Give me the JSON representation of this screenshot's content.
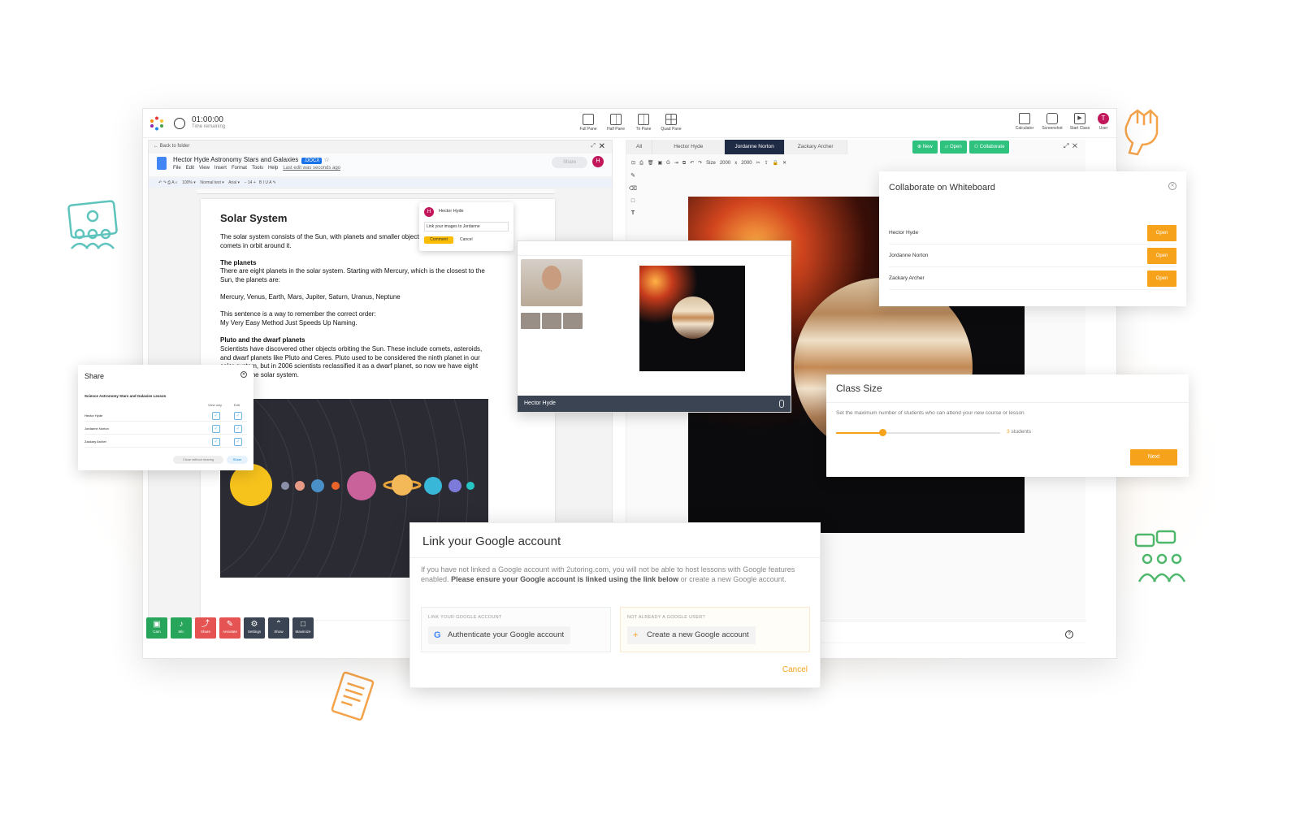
{
  "app": {
    "timer": {
      "value": "01:00:00",
      "label": "Time remaining"
    },
    "pane_modes": [
      "Full Pane",
      "Half Pane",
      "Tri Pane",
      "Quad Pane"
    ],
    "tools": [
      "Calculator",
      "Screenshot",
      "Start Class",
      "User"
    ],
    "user_initial": "T"
  },
  "doc": {
    "back": "Back to folder",
    "title": "Hector Hyde Astronomy Stars and Galaxies",
    "badge": ".DOCX",
    "menu": [
      "File",
      "Edit",
      "View",
      "Insert",
      "Format",
      "Tools",
      "Help"
    ],
    "last_edit": "Last edit was seconds ago",
    "share_label": "Share",
    "user_initial": "H",
    "toolbar": {
      "zoom": "100%",
      "style": "Normal text",
      "font": "Arial",
      "size": "14"
    },
    "heading": "Solar System",
    "paragraphs": {
      "p1": "The solar system consists of the Sun, with planets and smaller objects such as asteroids and comets in orbit around it.",
      "h2": "The planets",
      "p2": "There are eight planets in the solar system. Starting with Mercury, which is the closest to the Sun, the planets are:",
      "p3": "Mercury, Venus, Earth, Mars, Jupiter, Saturn, Uranus, Neptune",
      "p4": "This sentence is a way to remember the correct order:",
      "p5": "My Very Easy Method Just Speeds Up Naming.",
      "h3": "Pluto and the dwarf planets",
      "p6": "Scientists have discovered other objects orbiting the Sun. These include comets, asteroids, and dwarf planets like Pluto and Ceres. Pluto used to be considered the ninth planet in our solar system, but in 2006 scientists reclassified it as a dwarf planet, so now we have eight planets in the solar system."
    },
    "comment": {
      "author": "Hector Hyde",
      "text": "Link your images to Jordanne",
      "comment_btn": "Comment",
      "cancel_btn": "Cancel"
    }
  },
  "controls": [
    {
      "label": "Cam",
      "color": "#27a55a",
      "glyph": "▣"
    },
    {
      "label": "Mic",
      "color": "#27a55a",
      "glyph": "♪"
    },
    {
      "label": "Share",
      "color": "#e55353",
      "glyph": "⤴"
    },
    {
      "label": "Annotate",
      "color": "#e55353",
      "glyph": "✎"
    },
    {
      "label": "Settings",
      "color": "#3b4453",
      "glyph": "⚙"
    },
    {
      "label": "Show",
      "color": "#3b4453",
      "glyph": "⌃"
    },
    {
      "label": "Maximize",
      "color": "#3b4453",
      "glyph": "□"
    }
  ],
  "whiteboard": {
    "tabs": [
      "All",
      "Hector Hyde",
      "Jordanne Norton",
      "Zackary Archer"
    ],
    "active_tab": "Jordanne Norton",
    "actions": [
      "New",
      "Open",
      "Collaborate"
    ],
    "size_label": "Size",
    "width": "2000",
    "height": "2000"
  },
  "video": {
    "name": "Hector Hyde"
  },
  "share_modal": {
    "title": "Share",
    "lesson": "Science Astronomy Stars and Galaxies Lesson",
    "col_view": "View only",
    "col_edit": "Edit",
    "rows": [
      "Hector Hyde",
      "Jordanne Norton",
      "Zackary Archer"
    ],
    "close_btn": "Close without sharing",
    "share_btn": "Share"
  },
  "collab_modal": {
    "title": "Collaborate on Whiteboard",
    "rows": [
      "Hector Hyde",
      "Jordanne Norton",
      "Zackary Archer"
    ],
    "open_label": "Open"
  },
  "class_size": {
    "title": "Class Size",
    "desc": "Set the maximum number of students who can attend your new course or lesson",
    "count": "3",
    "unit": "students",
    "slider_fraction": 0.28,
    "next": "Next"
  },
  "google_modal": {
    "title": "Link your Google account",
    "desc_plain": "If you have not linked a Google account with 2utoring.com, you will not be able to host lessons with Google features enabled.",
    "desc_bold": "Please ensure your Google account is linked using the link below",
    "desc_tail": "or create a new Google account.",
    "left_caption": "LINK YOUR GOOGLE ACCOUNT",
    "left_button": "Authenticate your Google account",
    "right_caption": "NOT ALREADY A GOOGLE USER?",
    "right_button": "Create a new Google account",
    "cancel": "Cancel"
  },
  "colors": {
    "accent": "#f7a21b",
    "green": "#2ec27e",
    "navy": "#1f2a44"
  }
}
